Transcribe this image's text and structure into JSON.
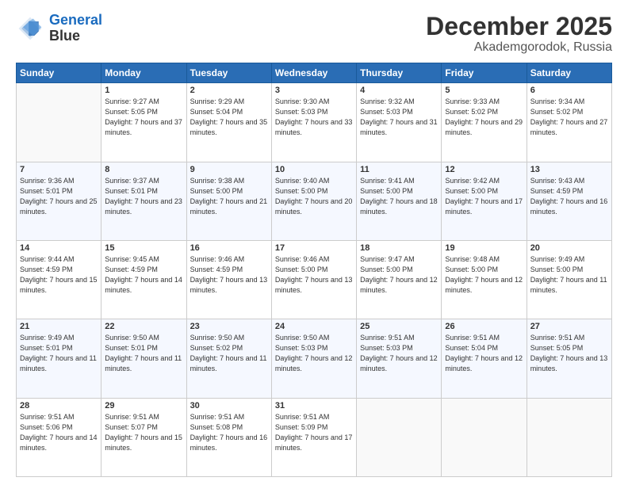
{
  "logo": {
    "line1": "General",
    "line2": "Blue"
  },
  "header": {
    "month": "December 2025",
    "location": "Akademgorodok, Russia"
  },
  "weekdays": [
    "Sunday",
    "Monday",
    "Tuesday",
    "Wednesday",
    "Thursday",
    "Friday",
    "Saturday"
  ],
  "weeks": [
    [
      {
        "day": "",
        "info": ""
      },
      {
        "day": "1",
        "info": "Sunrise: 9:27 AM\nSunset: 5:05 PM\nDaylight: 7 hours\nand 37 minutes."
      },
      {
        "day": "2",
        "info": "Sunrise: 9:29 AM\nSunset: 5:04 PM\nDaylight: 7 hours\nand 35 minutes."
      },
      {
        "day": "3",
        "info": "Sunrise: 9:30 AM\nSunset: 5:03 PM\nDaylight: 7 hours\nand 33 minutes."
      },
      {
        "day": "4",
        "info": "Sunrise: 9:32 AM\nSunset: 5:03 PM\nDaylight: 7 hours\nand 31 minutes."
      },
      {
        "day": "5",
        "info": "Sunrise: 9:33 AM\nSunset: 5:02 PM\nDaylight: 7 hours\nand 29 minutes."
      },
      {
        "day": "6",
        "info": "Sunrise: 9:34 AM\nSunset: 5:02 PM\nDaylight: 7 hours\nand 27 minutes."
      }
    ],
    [
      {
        "day": "7",
        "info": "Sunrise: 9:36 AM\nSunset: 5:01 PM\nDaylight: 7 hours\nand 25 minutes."
      },
      {
        "day": "8",
        "info": "Sunrise: 9:37 AM\nSunset: 5:01 PM\nDaylight: 7 hours\nand 23 minutes."
      },
      {
        "day": "9",
        "info": "Sunrise: 9:38 AM\nSunset: 5:00 PM\nDaylight: 7 hours\nand 21 minutes."
      },
      {
        "day": "10",
        "info": "Sunrise: 9:40 AM\nSunset: 5:00 PM\nDaylight: 7 hours\nand 20 minutes."
      },
      {
        "day": "11",
        "info": "Sunrise: 9:41 AM\nSunset: 5:00 PM\nDaylight: 7 hours\nand 18 minutes."
      },
      {
        "day": "12",
        "info": "Sunrise: 9:42 AM\nSunset: 5:00 PM\nDaylight: 7 hours\nand 17 minutes."
      },
      {
        "day": "13",
        "info": "Sunrise: 9:43 AM\nSunset: 4:59 PM\nDaylight: 7 hours\nand 16 minutes."
      }
    ],
    [
      {
        "day": "14",
        "info": "Sunrise: 9:44 AM\nSunset: 4:59 PM\nDaylight: 7 hours\nand 15 minutes."
      },
      {
        "day": "15",
        "info": "Sunrise: 9:45 AM\nSunset: 4:59 PM\nDaylight: 7 hours\nand 14 minutes."
      },
      {
        "day": "16",
        "info": "Sunrise: 9:46 AM\nSunset: 4:59 PM\nDaylight: 7 hours\nand 13 minutes."
      },
      {
        "day": "17",
        "info": "Sunrise: 9:46 AM\nSunset: 5:00 PM\nDaylight: 7 hours\nand 13 minutes."
      },
      {
        "day": "18",
        "info": "Sunrise: 9:47 AM\nSunset: 5:00 PM\nDaylight: 7 hours\nand 12 minutes."
      },
      {
        "day": "19",
        "info": "Sunrise: 9:48 AM\nSunset: 5:00 PM\nDaylight: 7 hours\nand 12 minutes."
      },
      {
        "day": "20",
        "info": "Sunrise: 9:49 AM\nSunset: 5:00 PM\nDaylight: 7 hours\nand 11 minutes."
      }
    ],
    [
      {
        "day": "21",
        "info": "Sunrise: 9:49 AM\nSunset: 5:01 PM\nDaylight: 7 hours\nand 11 minutes."
      },
      {
        "day": "22",
        "info": "Sunrise: 9:50 AM\nSunset: 5:01 PM\nDaylight: 7 hours\nand 11 minutes."
      },
      {
        "day": "23",
        "info": "Sunrise: 9:50 AM\nSunset: 5:02 PM\nDaylight: 7 hours\nand 11 minutes."
      },
      {
        "day": "24",
        "info": "Sunrise: 9:50 AM\nSunset: 5:03 PM\nDaylight: 7 hours\nand 12 minutes."
      },
      {
        "day": "25",
        "info": "Sunrise: 9:51 AM\nSunset: 5:03 PM\nDaylight: 7 hours\nand 12 minutes."
      },
      {
        "day": "26",
        "info": "Sunrise: 9:51 AM\nSunset: 5:04 PM\nDaylight: 7 hours\nand 12 minutes."
      },
      {
        "day": "27",
        "info": "Sunrise: 9:51 AM\nSunset: 5:05 PM\nDaylight: 7 hours\nand 13 minutes."
      }
    ],
    [
      {
        "day": "28",
        "info": "Sunrise: 9:51 AM\nSunset: 5:06 PM\nDaylight: 7 hours\nand 14 minutes."
      },
      {
        "day": "29",
        "info": "Sunrise: 9:51 AM\nSunset: 5:07 PM\nDaylight: 7 hours\nand 15 minutes."
      },
      {
        "day": "30",
        "info": "Sunrise: 9:51 AM\nSunset: 5:08 PM\nDaylight: 7 hours\nand 16 minutes."
      },
      {
        "day": "31",
        "info": "Sunrise: 9:51 AM\nSunset: 5:09 PM\nDaylight: 7 hours\nand 17 minutes."
      },
      {
        "day": "",
        "info": ""
      },
      {
        "day": "",
        "info": ""
      },
      {
        "day": "",
        "info": ""
      }
    ]
  ]
}
